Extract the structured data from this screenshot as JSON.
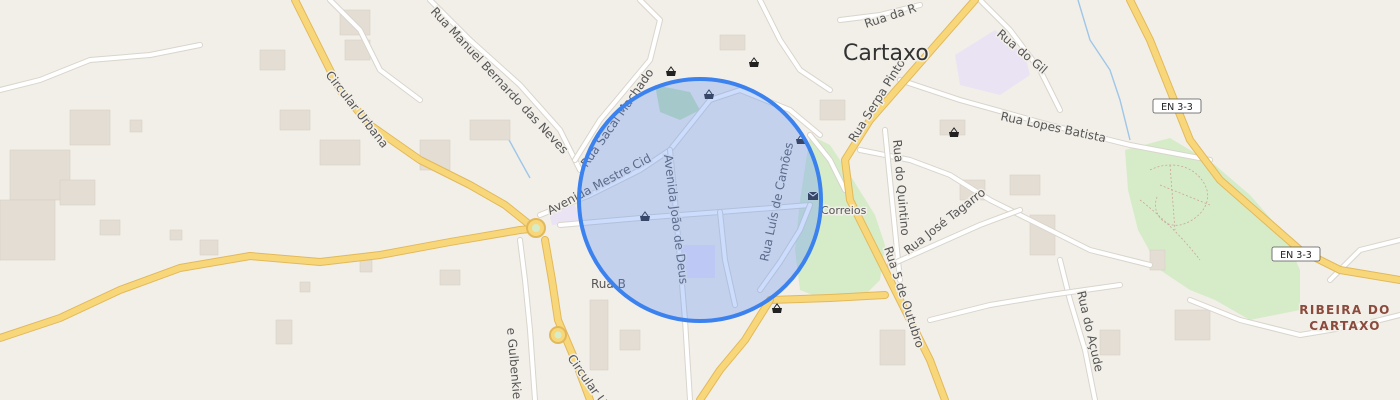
{
  "map": {
    "town": "Cartaxo",
    "place": [
      "RIBEIRA DO",
      "CARTAXO"
    ],
    "streets": [
      "Rua Manuel Bernardo das Neves",
      "Circular Urbana",
      "Rua Sacal Machado",
      "Avenida Mestre Cid",
      "Avenida João de Deus",
      "Rua Luís de Camões",
      "Rua Serpa Pinto",
      "Rua do Quintino",
      "Rua José Tagarro",
      "Rua 5 de Outubro",
      "Rua Lopes Batista",
      "Rua do Gil",
      "Rua da R",
      "Rua B",
      "Rua do Açude",
      "e Gulbenkien",
      "Circular U"
    ],
    "shields": [
      "EN 3-3",
      "EN 3-3"
    ],
    "poi": {
      "post_office": "Correios"
    },
    "icons": {
      "shop": "basket-icon",
      "post": "mail-icon"
    },
    "selection": {
      "shape": "circle",
      "color": "#3c82ee"
    },
    "colors": {
      "background": "#f2efe9",
      "major_road": "#f8d77a",
      "minor_road": "#ffffff",
      "park": "#d6ecc9",
      "civic": "#e9e3f4",
      "water": "#9fc6e8"
    }
  }
}
